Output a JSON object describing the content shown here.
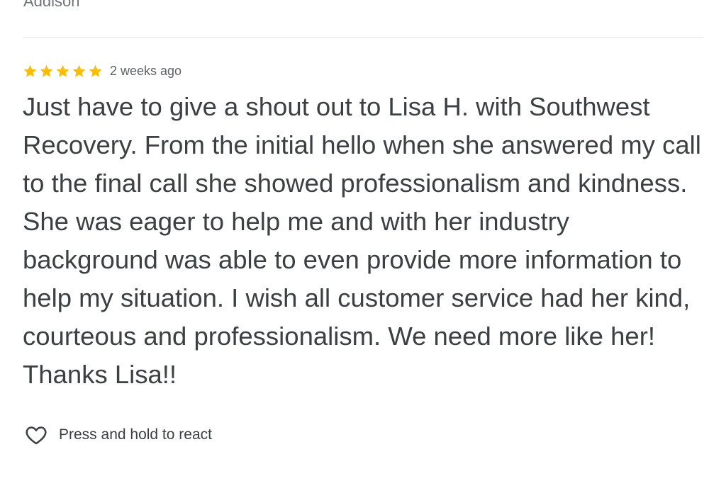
{
  "reviewer": {
    "name": "Addison"
  },
  "review": {
    "rating": 5,
    "rating_max": 5,
    "star_color": "#fbbc04",
    "date": "2 weeks ago",
    "text": "Just have to give a shout out to Lisa H. with Southwest Recovery. From the initial hello when she answered my call to the final call she showed professionalism and kindness. She was eager to help me and with her industry background was able to even provide more information to help my situation. I wish all customer service had her kind, courteous and professionalism. We need more like her! Thanks Lisa!!"
  },
  "react": {
    "icon": "heart-outline-icon",
    "label": "Press and hold to react"
  }
}
